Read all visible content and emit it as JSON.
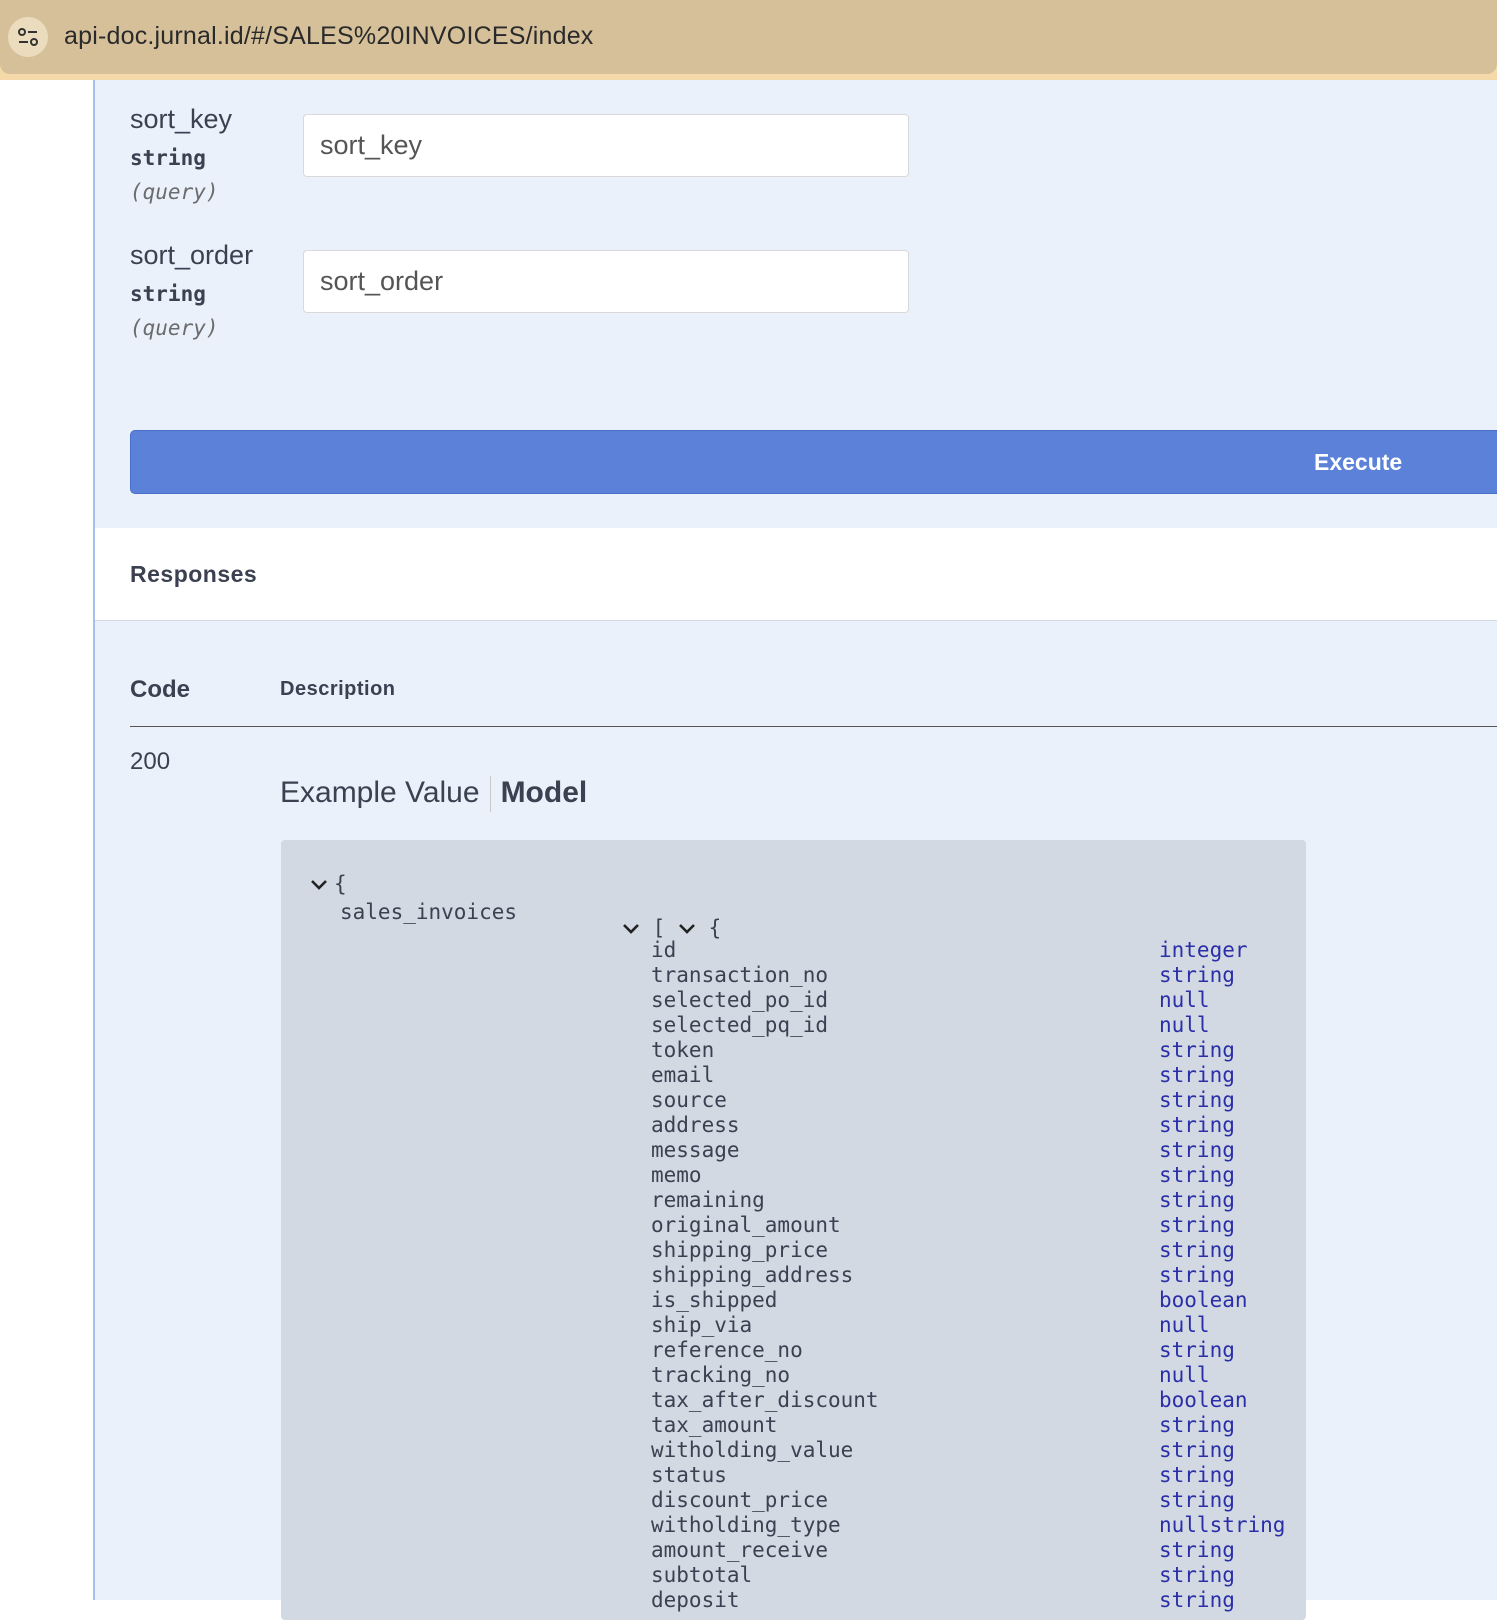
{
  "browser": {
    "url": "api-doc.jurnal.id/#/SALES%20INVOICES/index",
    "site_icon": "tune-icon"
  },
  "params": [
    {
      "name": "sort_key",
      "type": "string",
      "in": "(query)",
      "placeholder": "sort_key"
    },
    {
      "name": "sort_order",
      "type": "string",
      "in": "(query)",
      "placeholder": "sort_order"
    }
  ],
  "execute_label": "Execute",
  "responses": {
    "title": "Responses",
    "col_code": "Code",
    "col_description": "Description",
    "code": "200",
    "tab_example": "Example Value",
    "tab_model": "Model"
  },
  "model": {
    "open_brace": "{",
    "property": "sales_invoices",
    "array_open": "[",
    "object_open": "{",
    "fields": [
      {
        "name": "id",
        "type": "integer"
      },
      {
        "name": "transaction_no",
        "type": "string"
      },
      {
        "name": "selected_po_id",
        "type": "null"
      },
      {
        "name": "selected_pq_id",
        "type": "null"
      },
      {
        "name": "token",
        "type": "string"
      },
      {
        "name": "email",
        "type": "string"
      },
      {
        "name": "source",
        "type": "string"
      },
      {
        "name": "address",
        "type": "string"
      },
      {
        "name": "message",
        "type": "string"
      },
      {
        "name": "memo",
        "type": "string"
      },
      {
        "name": "remaining",
        "type": "string"
      },
      {
        "name": "original_amount",
        "type": "string"
      },
      {
        "name": "shipping_price",
        "type": "string"
      },
      {
        "name": "shipping_address",
        "type": "string"
      },
      {
        "name": "is_shipped",
        "type": "boolean"
      },
      {
        "name": "ship_via",
        "type": "null"
      },
      {
        "name": "reference_no",
        "type": "string"
      },
      {
        "name": "tracking_no",
        "type": "null"
      },
      {
        "name": "tax_after_discount",
        "type": "boolean"
      },
      {
        "name": "tax_amount",
        "type": "string"
      },
      {
        "name": "witholding_value",
        "type": "string"
      },
      {
        "name": "status",
        "type": "string"
      },
      {
        "name": "discount_price",
        "type": "string"
      },
      {
        "name": "witholding_type",
        "type": "nullstring"
      },
      {
        "name": "amount_receive",
        "type": "string"
      },
      {
        "name": "subtotal",
        "type": "string"
      },
      {
        "name": "deposit",
        "type": "string"
      }
    ]
  }
}
